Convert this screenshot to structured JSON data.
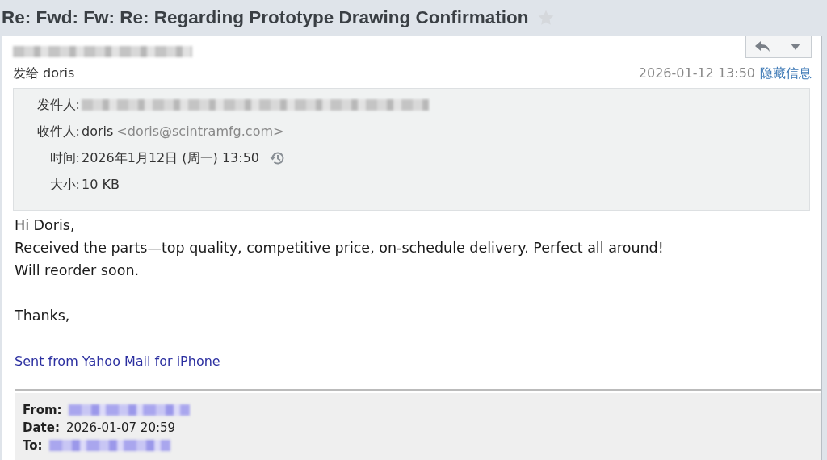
{
  "subject": {
    "title": "Re: Fwd: Fw: Re: Regarding Prototype Drawing Confirmation",
    "starred": false
  },
  "header": {
    "sender": {
      "kind": "redacted"
    },
    "sent_to": "发给 doris",
    "date": "2026-01-12 13:50",
    "toggle_link": "隐藏信息"
  },
  "details": [
    {
      "label": "发件人:",
      "kind": "redacted"
    },
    {
      "label": "收件人:",
      "kind": "contact",
      "name": "doris",
      "address": "<doris@scintramfg.com>"
    },
    {
      "label": "时间:",
      "kind": "time",
      "value": "2026年1月12日 (周一) 13:50"
    },
    {
      "label": "大小:",
      "kind": "text",
      "value": "10 KB"
    }
  ],
  "body": [
    [
      "Hi Doris,",
      "Received the parts—top quality, competitive price, on-schedule delivery. Perfect all around!",
      "Will reorder soon."
    ],
    [
      "Thanks,"
    ]
  ],
  "signature_link": "Sent from Yahoo Mail for iPhone",
  "quoted": [
    {
      "label": "From:",
      "kind": "redacted"
    },
    {
      "label": "Date:",
      "kind": "text",
      "value": "2026-01-07 20:59"
    },
    {
      "label": "To:",
      "kind": "redacted"
    }
  ]
}
